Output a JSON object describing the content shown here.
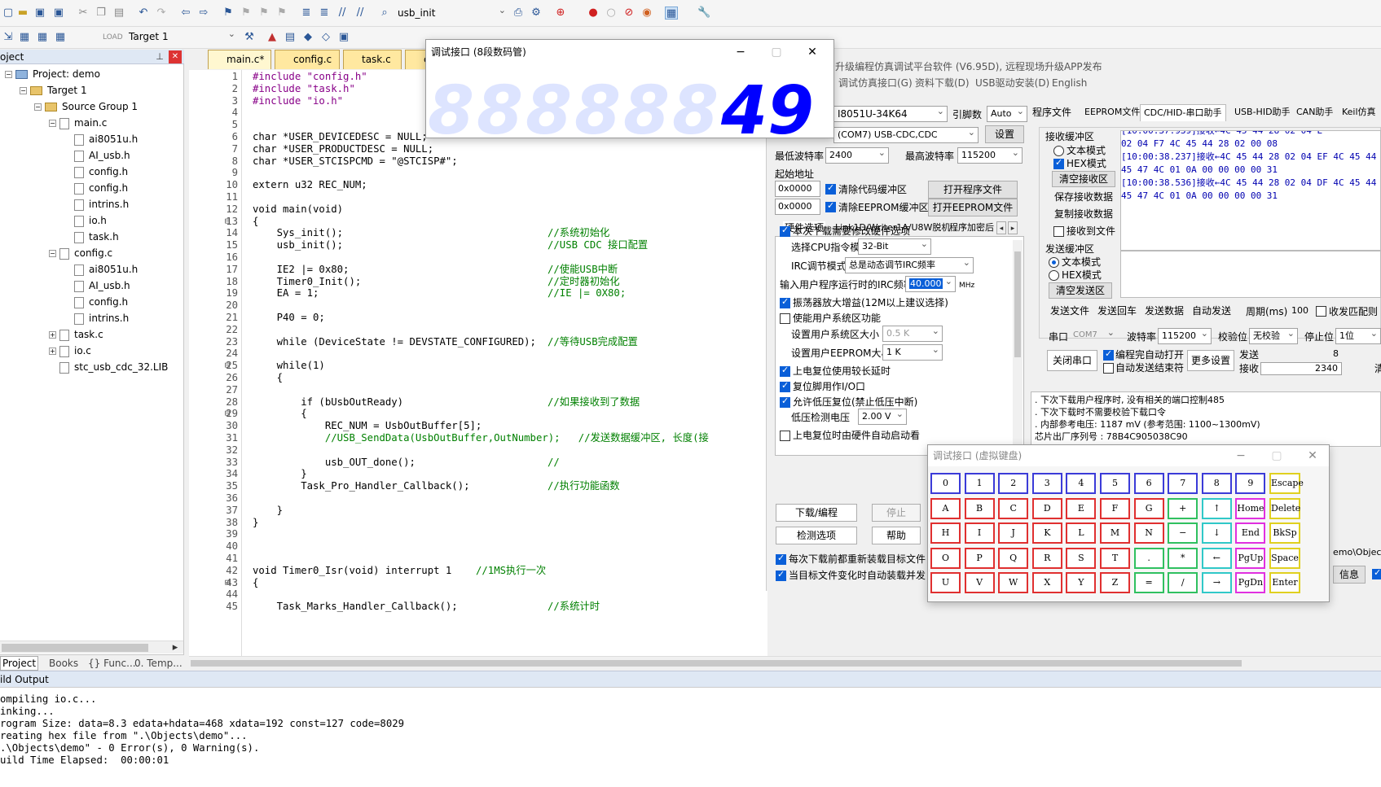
{
  "toolbar1": {
    "function_combo": "usb_init"
  },
  "toolbar2": {
    "target_combo": "Target 1"
  },
  "project": {
    "title": "oject",
    "tree": [
      {
        "label": "Project: demo",
        "level": 0,
        "kind": "root",
        "expander": "−"
      },
      {
        "label": "Target 1",
        "level": 1,
        "kind": "folder",
        "expander": "−"
      },
      {
        "label": "Source Group 1",
        "level": 2,
        "kind": "folder",
        "expander": "−"
      },
      {
        "label": "main.c",
        "level": 3,
        "kind": "file",
        "expander": "−"
      },
      {
        "label": "ai8051u.h",
        "level": 4,
        "kind": "file",
        "expander": ""
      },
      {
        "label": "AI_usb.h",
        "level": 4,
        "kind": "file",
        "expander": ""
      },
      {
        "label": "config.h",
        "level": 4,
        "kind": "file",
        "expander": ""
      },
      {
        "label": "config.h",
        "level": 4,
        "kind": "file",
        "expander": ""
      },
      {
        "label": "intrins.h",
        "level": 4,
        "kind": "file",
        "expander": ""
      },
      {
        "label": "io.h",
        "level": 4,
        "kind": "file",
        "expander": ""
      },
      {
        "label": "task.h",
        "level": 4,
        "kind": "file",
        "expander": ""
      },
      {
        "label": "config.c",
        "level": 3,
        "kind": "file",
        "expander": "−"
      },
      {
        "label": "ai8051u.h",
        "level": 4,
        "kind": "file",
        "expander": ""
      },
      {
        "label": "AI_usb.h",
        "level": 4,
        "kind": "file",
        "expander": ""
      },
      {
        "label": "config.h",
        "level": 4,
        "kind": "file",
        "expander": ""
      },
      {
        "label": "intrins.h",
        "level": 4,
        "kind": "file",
        "expander": ""
      },
      {
        "label": "task.c",
        "level": 3,
        "kind": "file",
        "expander": "+"
      },
      {
        "label": "io.c",
        "level": 3,
        "kind": "file",
        "expander": "+"
      },
      {
        "label": "stc_usb_cdc_32.LIB",
        "level": 3,
        "kind": "file",
        "expander": ""
      }
    ],
    "bottom_tabs": [
      "Project",
      "Books",
      "{} Func...",
      "0. Temp..."
    ]
  },
  "editor_tabs": [
    "main.c*",
    "config.c",
    "task.c",
    "c"
  ],
  "code_lines": [
    {
      "n": "1",
      "t": "#include \"config.h\"",
      "c": "pp"
    },
    {
      "n": "2",
      "t": "#include \"task.h\"",
      "c": "pp"
    },
    {
      "n": "3",
      "t": "#include \"io.h\"",
      "c": "pp"
    },
    {
      "n": "4",
      "t": "",
      "c": ""
    },
    {
      "n": "5",
      "t": "",
      "c": ""
    },
    {
      "n": "6",
      "t": "char *USER_DEVICEDESC = NULL;",
      "c": ""
    },
    {
      "n": "7",
      "t": "char *USER_PRODUCTDESC = NULL;",
      "c": ""
    },
    {
      "n": "8",
      "t": "char *USER_STCISPCMD = \"@STCISP#\";",
      "c": ""
    },
    {
      "n": "9",
      "t": "",
      "c": ""
    },
    {
      "n": "10",
      "t": "extern u32 REC_NUM;",
      "c": ""
    },
    {
      "n": "11",
      "t": "",
      "c": ""
    },
    {
      "n": "12",
      "t": "void main(void)",
      "c": ""
    },
    {
      "n": "13",
      "t": "{",
      "c": ""
    },
    {
      "n": "14",
      "t": "    Sys_init();",
      "cm": "//系统初始化"
    },
    {
      "n": "15",
      "t": "    usb_init();",
      "cm": "//USB CDC 接口配置"
    },
    {
      "n": "16",
      "t": "",
      "c": ""
    },
    {
      "n": "17",
      "t": "    IE2 |= 0x80;",
      "cm": "//使能USB中断"
    },
    {
      "n": "18",
      "t": "    Timer0_Init();",
      "cm": "//定时器初始化"
    },
    {
      "n": "19",
      "t": "    EA = 1;",
      "cm": "//IE |= 0X80;"
    },
    {
      "n": "20",
      "t": "",
      "c": ""
    },
    {
      "n": "21",
      "t": "    P40 = 0;",
      "c": ""
    },
    {
      "n": "22",
      "t": "",
      "c": ""
    },
    {
      "n": "23",
      "t": "    while (DeviceState != DEVSTATE_CONFIGURED);",
      "cm": "//等待USB完成配置"
    },
    {
      "n": "24",
      "t": "",
      "c": ""
    },
    {
      "n": "25",
      "t": "    while(1)",
      "c": ""
    },
    {
      "n": "26",
      "t": "    {",
      "c": ""
    },
    {
      "n": "27",
      "t": "",
      "c": ""
    },
    {
      "n": "28",
      "t": "        if (bUsbOutReady)",
      "cm": "//如果接收到了数据"
    },
    {
      "n": "29",
      "t": "        {",
      "c": ""
    },
    {
      "n": "30",
      "t": "            REC_NUM = UsbOutBuffer[5];",
      "c": ""
    },
    {
      "n": "31",
      "t": "            //USB_SendData(UsbOutBuffer,OutNumber);   //发送数据缓冲区, 长度(接",
      "c": "cm"
    },
    {
      "n": "32",
      "t": "",
      "c": ""
    },
    {
      "n": "33",
      "t": "            usb_OUT_done();",
      "cm": "//"
    },
    {
      "n": "34",
      "t": "        }",
      "c": ""
    },
    {
      "n": "35",
      "t": "        Task_Pro_Handler_Callback();",
      "cm": "//执行功能函数"
    },
    {
      "n": "36",
      "t": "",
      "c": ""
    },
    {
      "n": "37",
      "t": "    }",
      "c": ""
    },
    {
      "n": "38",
      "t": "}",
      "c": ""
    },
    {
      "n": "39",
      "t": "",
      "c": ""
    },
    {
      "n": "40",
      "t": "",
      "c": ""
    },
    {
      "n": "41",
      "t": "",
      "c": ""
    },
    {
      "n": "42",
      "t": "void Timer0_Isr(void) interrupt 1",
      "cm2": "//1MS执行一次"
    },
    {
      "n": "43",
      "t": "{",
      "c": ""
    },
    {
      "n": "44",
      "t": "",
      "c": ""
    },
    {
      "n": "45",
      "t": "    Task_Marks_Handler_Callback();",
      "cm": "//系统计时"
    }
  ],
  "build_output": {
    "title": "ild Output",
    "lines": [
      "ompiling io.c...",
      "inking...",
      "rogram Size: data=8.3 edata+hdata=468 xdata=192 const=127 code=8029",
      "reating hex file from \".\\Objects\\demo\"...",
      ".\\Objects\\demo\" - 0 Error(s), 0 Warning(s).",
      "uild Time Elapsed:  00:00:01"
    ]
  },
  "seg_window": {
    "title": "调试接口 (8段数码管)",
    "ghost": "8.8.8.8.8.8.",
    "value": "49"
  },
  "isp": {
    "title": "升级编程仿真调试平台软件 (V6.95D), 远程现场升级APP发布",
    "menu": [
      "(O)",
      "工具(T)",
      "调试仿真接口(G)",
      "资料下载(D)",
      "USB驱动安装(D)",
      "English"
    ],
    "mcu_combo": "I8051U-34K64",
    "pin_label": "引脚数",
    "pin_combo": "Auto",
    "port_combo": "(COM7) USB-CDC,CDC",
    "port_settings": "设置",
    "min_baud_label": "最低波特率",
    "min_baud": "2400",
    "max_baud_label": "最高波特率",
    "max_baud": "115200",
    "start_addr_label": "起始地址",
    "addr1": "0x0000",
    "addr2": "0x0000",
    "clear_code": "清除代码缓冲区",
    "clear_eeprom": "清除EEPROM缓冲区",
    "open_program": "打开程序文件",
    "open_eeprom": "打开EEPROM文件",
    "hw_tabs": [
      "硬件选项",
      "Link1D/Writer1A/U8W脱机",
      "程序加密后"
    ],
    "opt_modify_hw": "本次下载需要修改硬件选项",
    "cpu_mode_label": "选择CPU指令模式",
    "cpu_mode": "32-Bit",
    "irc_label": "IRC调节模式",
    "irc_mode": "总是动态调节IRC频率",
    "irc_freq_label": "输入用户程序运行时的IRC频率",
    "irc_freq": "40.000",
    "irc_unit": "MHz",
    "osc_gain": "振荡器放大增益(12M以上建议选择)",
    "user_sys_area": "使能用户系统区功能",
    "sys_area_size_label": "设置用户系统区大小",
    "sys_area_size": "0.5 K",
    "eeprom_size_label": "设置用户EEPROM大小",
    "eeprom_size": "1  K",
    "long_delay": "上电复位使用较长延时",
    "reset_io": "复位脚用作I/O口",
    "low_volt_reset": "允许低压复位(禁止低压中断)",
    "low_volt_label": "低压检测电压",
    "low_volt": "2.00 V",
    "hw_auto_start": "上电复位时由硬件自动启动看",
    "download_btn": "下载/编程",
    "stop_btn": "停止",
    "check_btn": "检测选项",
    "help_btn": "帮助",
    "reload_each": "每次下载前都重新装载目标文件",
    "auto_reload": "当目标文件变化时自动装载并发"
  },
  "right_panel": {
    "tabs": [
      "程序文件",
      "EEPROM文件",
      "CDC/HID-串口助手",
      "USB-HID助手",
      "CAN助手",
      "Keil仿真"
    ],
    "recv_title": "接收缓冲区",
    "text_mode": "文本模式",
    "hex_mode": "HEX模式",
    "clear_recv": "清空接收区",
    "save_recv": "保存接收数据",
    "copy_recv": "复制接收数据",
    "recv_to_file": "接收到文件",
    "recv_lines": [
      "[10:00:37.939]接收←4C 45 44 28 02 04 E",
      "             02 04 F7 4C 45 44 28 02 00 08",
      "[10:00:38.237]接收←4C 45 44 28 02 04 EF 4C 45 44 28",
      "             45 47 4C 01 0A 00 00 00 00 31",
      "[10:00:38.536]接收←4C 45 44 28 02 04 DF 4C 45 44 28",
      "             45 47 4C 01 0A 00 00 00 00 31"
    ],
    "send_title": "发送缓冲区",
    "send_text_mode": "文本模式",
    "send_hex_mode": "HEX模式",
    "clear_send": "清空发送区",
    "send_file": "发送文件",
    "send_return": "发送回车",
    "send_data": "发送数据",
    "auto_send": "自动发送",
    "period_label": "周期(ms)",
    "period": "100",
    "send_other": "收发匹配则",
    "port_label": "串口",
    "port": "COM7",
    "baud_label": "波特率",
    "baud": "115200",
    "parity_label": "校验位",
    "parity": "无校验",
    "stop_label": "停止位",
    "stop": "1位",
    "close_port": "关闭串口",
    "auto_open": "编程完自动打开",
    "auto_send_end": "自动发送结束符",
    "more_settings": "更多设置",
    "send_count_label": "发送",
    "send_count": "8",
    "recv_count_label": "接收",
    "recv_count": "2340",
    "clear_count": "清"
  },
  "info_panel": {
    "lines": [
      "  . 下次下载用户程序时, 没有相关的端口控制485",
      "  . 下次下载时不需要校验下载口令",
      "  . 内部参考电压: 1187 mV (参考范围: 1100~1300mV)",
      "芯片出厂序列号 : 78B4C905038C90"
    ],
    "path_tail": "emo\\Object",
    "info_btn": "信息"
  },
  "keyboard": {
    "title": "调试接口 (虚拟键盘)",
    "rows": [
      [
        "0",
        "1",
        "2",
        "3",
        "4",
        "5",
        "6",
        "7",
        "8",
        "9",
        "Escape"
      ],
      [
        "A",
        "B",
        "C",
        "D",
        "E",
        "F",
        "G",
        "+",
        "↑",
        "Home",
        "Delete"
      ],
      [
        "H",
        "I",
        "J",
        "K",
        "L",
        "M",
        "N",
        "−",
        "↓",
        "End",
        "BkSp"
      ],
      [
        "O",
        "P",
        "Q",
        "R",
        "S",
        "T",
        ".",
        "*",
        "←",
        "PgUp",
        "Space"
      ],
      [
        "U",
        "V",
        "W",
        "X",
        "Y",
        "Z",
        "=",
        "/",
        "→",
        "PgDn",
        "Enter"
      ]
    ],
    "colors": {
      "digits": "#3b3bd8",
      "letters": "#e03030",
      "ops": "#30c060",
      "arrows": "#30c8c8",
      "nav": "#e030e0",
      "func": "#e0d020"
    }
  }
}
